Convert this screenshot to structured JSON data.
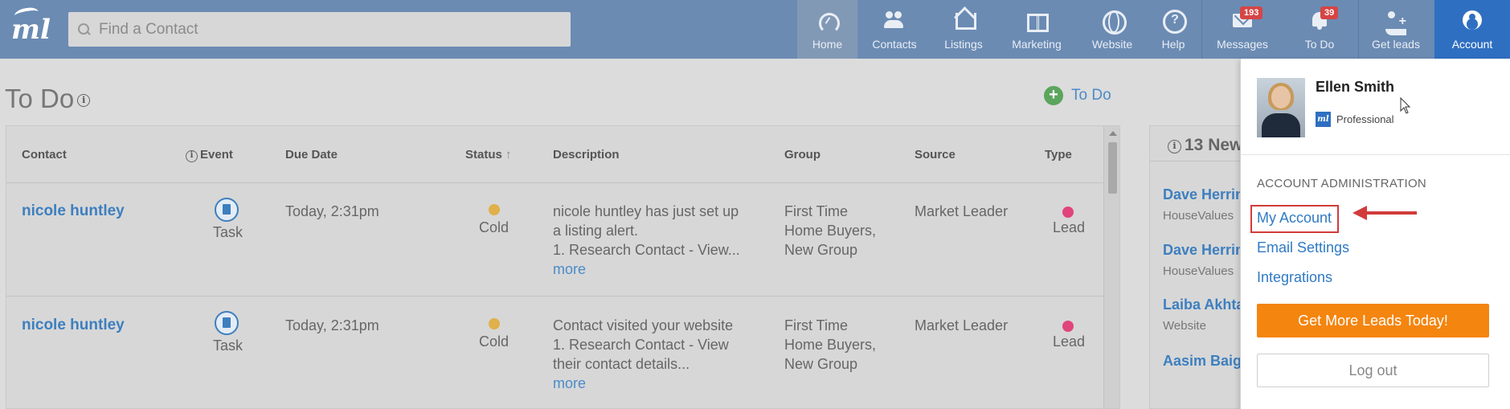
{
  "nav": {
    "search_placeholder": "Find a Contact",
    "items": [
      {
        "label": "Home",
        "icon": "gauge-icon"
      },
      {
        "label": "Contacts",
        "icon": "people-icon"
      },
      {
        "label": "Listings",
        "icon": "house-icon"
      },
      {
        "label": "Marketing",
        "icon": "book-icon"
      },
      {
        "label": "Website",
        "icon": "globe-icon"
      },
      {
        "label": "Help",
        "icon": "help-icon"
      },
      {
        "label": "Messages",
        "icon": "mail-icon",
        "badge": "193"
      },
      {
        "label": "To Do",
        "icon": "bell-icon",
        "badge": "39"
      },
      {
        "label": "Get leads",
        "icon": "add-user-icon"
      },
      {
        "label": "Account",
        "icon": "account-icon"
      }
    ],
    "colors": {
      "bar": "#6b8bb3",
      "account_active": "#2f6fc1",
      "badge": "#d64545"
    }
  },
  "page": {
    "title": "To Do",
    "add_label": "To Do"
  },
  "table": {
    "columns": [
      "Contact",
      "Event",
      "Due Date",
      "Status",
      "Description",
      "Group",
      "Source",
      "Type"
    ],
    "rows": [
      {
        "contact": "nicole huntley",
        "event": "Task",
        "due": "Today, 2:31pm",
        "status": "Cold",
        "desc_line1": "nicole huntley has just set up",
        "desc_line2": "a listing alert.",
        "desc_line3": "1. Research Contact - View...",
        "more": "more",
        "group_line1": "First Time",
        "group_line2": "Home Buyers,",
        "group_line3": "New Group",
        "source": "Market Leader",
        "type": "Lead"
      },
      {
        "contact": "nicole huntley",
        "event": "Task",
        "due": "Today, 2:31pm",
        "status": "Cold",
        "desc_line1": "Contact visited your website",
        "desc_line2": "1. Research Contact - View",
        "desc_line3": "their contact details...",
        "more": "more",
        "group_line1": "First Time",
        "group_line2": "Home Buyers,",
        "group_line3": "New Group",
        "source": "Market Leader",
        "type": "Lead"
      }
    ],
    "colors": {
      "cold": "#e0b04a",
      "lead": "#e0457b"
    }
  },
  "leads": {
    "heading": "13 New",
    "items": [
      {
        "name": "Dave Herrin",
        "source": "HouseValues"
      },
      {
        "name": "Dave Herrin",
        "source": "HouseValues"
      },
      {
        "name": "Laiba Akhta",
        "source": "Website"
      },
      {
        "name": "Aasim Baig",
        "source": ""
      }
    ]
  },
  "account_menu": {
    "user_name": "Ellen Smith",
    "plan": "Professional",
    "section_label": "ACCOUNT ADMINISTRATION",
    "links": [
      "My Account",
      "Email Settings",
      "Integrations"
    ],
    "cta": "Get More Leads Today!",
    "logout": "Log out",
    "colors": {
      "cta": "#f4850f",
      "link": "#2f7ac4",
      "highlight": "#d23b3b"
    }
  }
}
